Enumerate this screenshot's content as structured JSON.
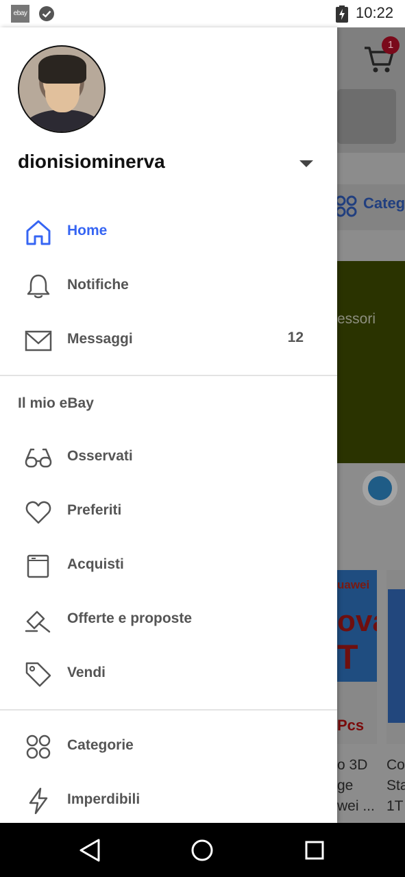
{
  "status_bar": {
    "app_icon_text": "ebay",
    "time": "10:22"
  },
  "background_app": {
    "cart_badge": "1",
    "categories_label": "Categ",
    "banner_text": "essori",
    "product_1": {
      "image_text_1": "uawei",
      "image_text_2": "ova",
      "image_text_3": "T",
      "image_text_4": "Pcs",
      "title": "o 3D\nge\nwei ..."
    },
    "product_2": {
      "title": "Co\nSta\n1T"
    }
  },
  "drawer": {
    "username": "dionisiominerva",
    "accent_color": "#3665f3",
    "primary_items": [
      {
        "label": "Home",
        "icon": "home-icon",
        "active": true
      },
      {
        "label": "Notifiche",
        "icon": "bell-icon"
      },
      {
        "label": "Messaggi",
        "icon": "mail-icon",
        "count": "12"
      }
    ],
    "my_ebay_title": "Il mio eBay",
    "my_ebay_items": [
      {
        "label": "Osservati",
        "icon": "glasses-icon"
      },
      {
        "label": "Preferiti",
        "icon": "heart-icon"
      },
      {
        "label": "Acquisti",
        "icon": "purchases-icon"
      },
      {
        "label": "Offerte e proposte",
        "icon": "gavel-icon"
      },
      {
        "label": "Vendi",
        "icon": "tag-icon"
      }
    ],
    "more_items": [
      {
        "label": "Categorie",
        "icon": "categories-icon"
      },
      {
        "label": "Imperdibili",
        "icon": "lightning-icon"
      }
    ]
  }
}
